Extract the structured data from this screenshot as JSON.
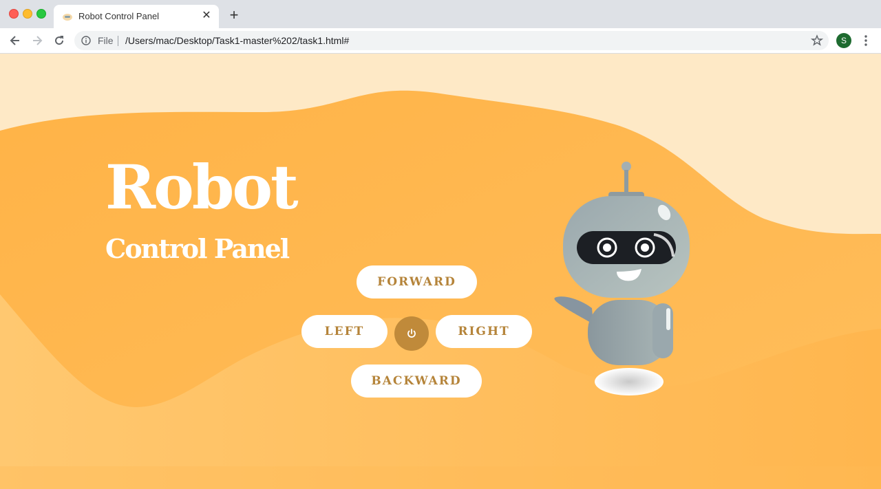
{
  "browser": {
    "tab_title": "Robot Control Panel",
    "new_tab_label": "+",
    "close_label": "✕",
    "file_label": "File",
    "url": "/Users/mac/Desktop/Task1-master%202/task1.html#",
    "profile_initial": "S"
  },
  "page": {
    "title": "Robot",
    "subtitle": "Control Panel",
    "controls": {
      "forward": "FORWARD",
      "left": "LEFT",
      "right": "RIGHT",
      "backward": "BACKWARD"
    }
  },
  "colors": {
    "background_light": "#fee9c6",
    "background_orange": "#ffc266",
    "button_text": "#b5843a",
    "power_button": "#c08a3a"
  },
  "icons": [
    "back-icon",
    "forward-icon",
    "reload-icon",
    "info-icon",
    "star-icon",
    "menu-icon",
    "power-icon"
  ]
}
